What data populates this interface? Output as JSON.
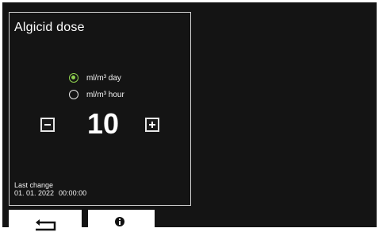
{
  "panel": {
    "title": "Algicid dose"
  },
  "unit_options": [
    {
      "label": "ml/m³ day",
      "selected": true
    },
    {
      "label": "ml/m³ hour",
      "selected": false
    }
  ],
  "dose": {
    "value": "10"
  },
  "last_change": {
    "label": "Last change",
    "date": "01. 01. 2022",
    "time": "00:00:00"
  },
  "softkeys": {
    "back_icon": "return-arrow-icon",
    "info_icon": "info-icon"
  },
  "colors": {
    "background": "#141414",
    "text": "#ffffff",
    "selected_radio": "#8fd14f",
    "softkey_background": "#ffffff"
  }
}
